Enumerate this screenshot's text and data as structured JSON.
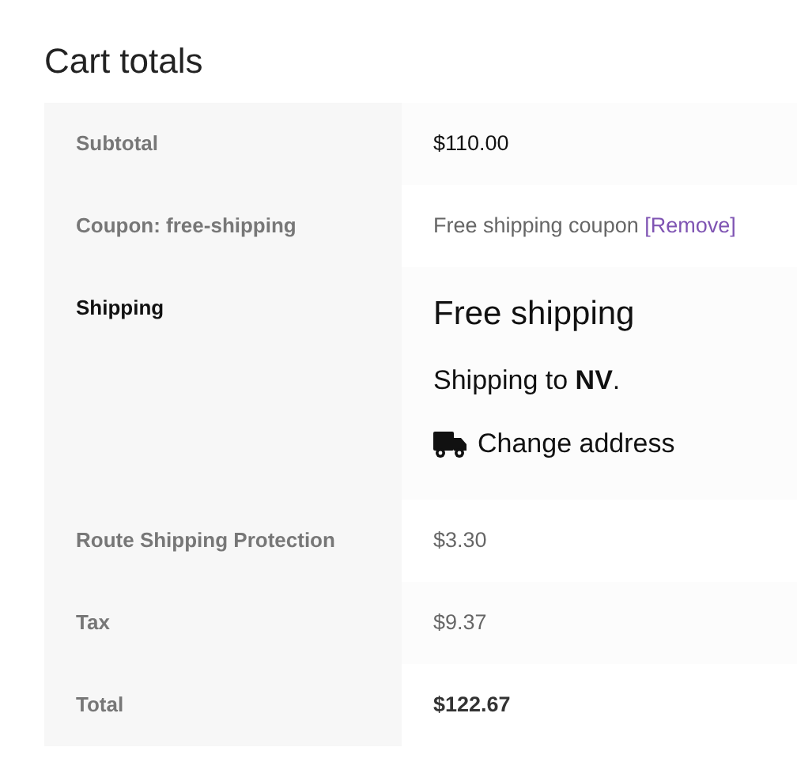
{
  "title": "Cart totals",
  "rows": [
    {
      "kind": "subtotal",
      "label": "Subtotal",
      "value": "$110.00"
    },
    {
      "kind": "coupon",
      "label": "Coupon: free-shipping",
      "value": "Free shipping coupon",
      "link": "[Remove]"
    },
    {
      "kind": "shipping",
      "label": "Shipping",
      "method": "Free shipping",
      "destination": "Shipping to **NV**.",
      "link": "Change address"
    },
    {
      "kind": "fee",
      "label": "Route Shipping Protection",
      "value": "$3.30"
    },
    {
      "kind": "fee",
      "label": "Tax",
      "value": "$9.37"
    },
    {
      "kind": "total",
      "label": "Total",
      "value": "$122.67"
    }
  ]
}
